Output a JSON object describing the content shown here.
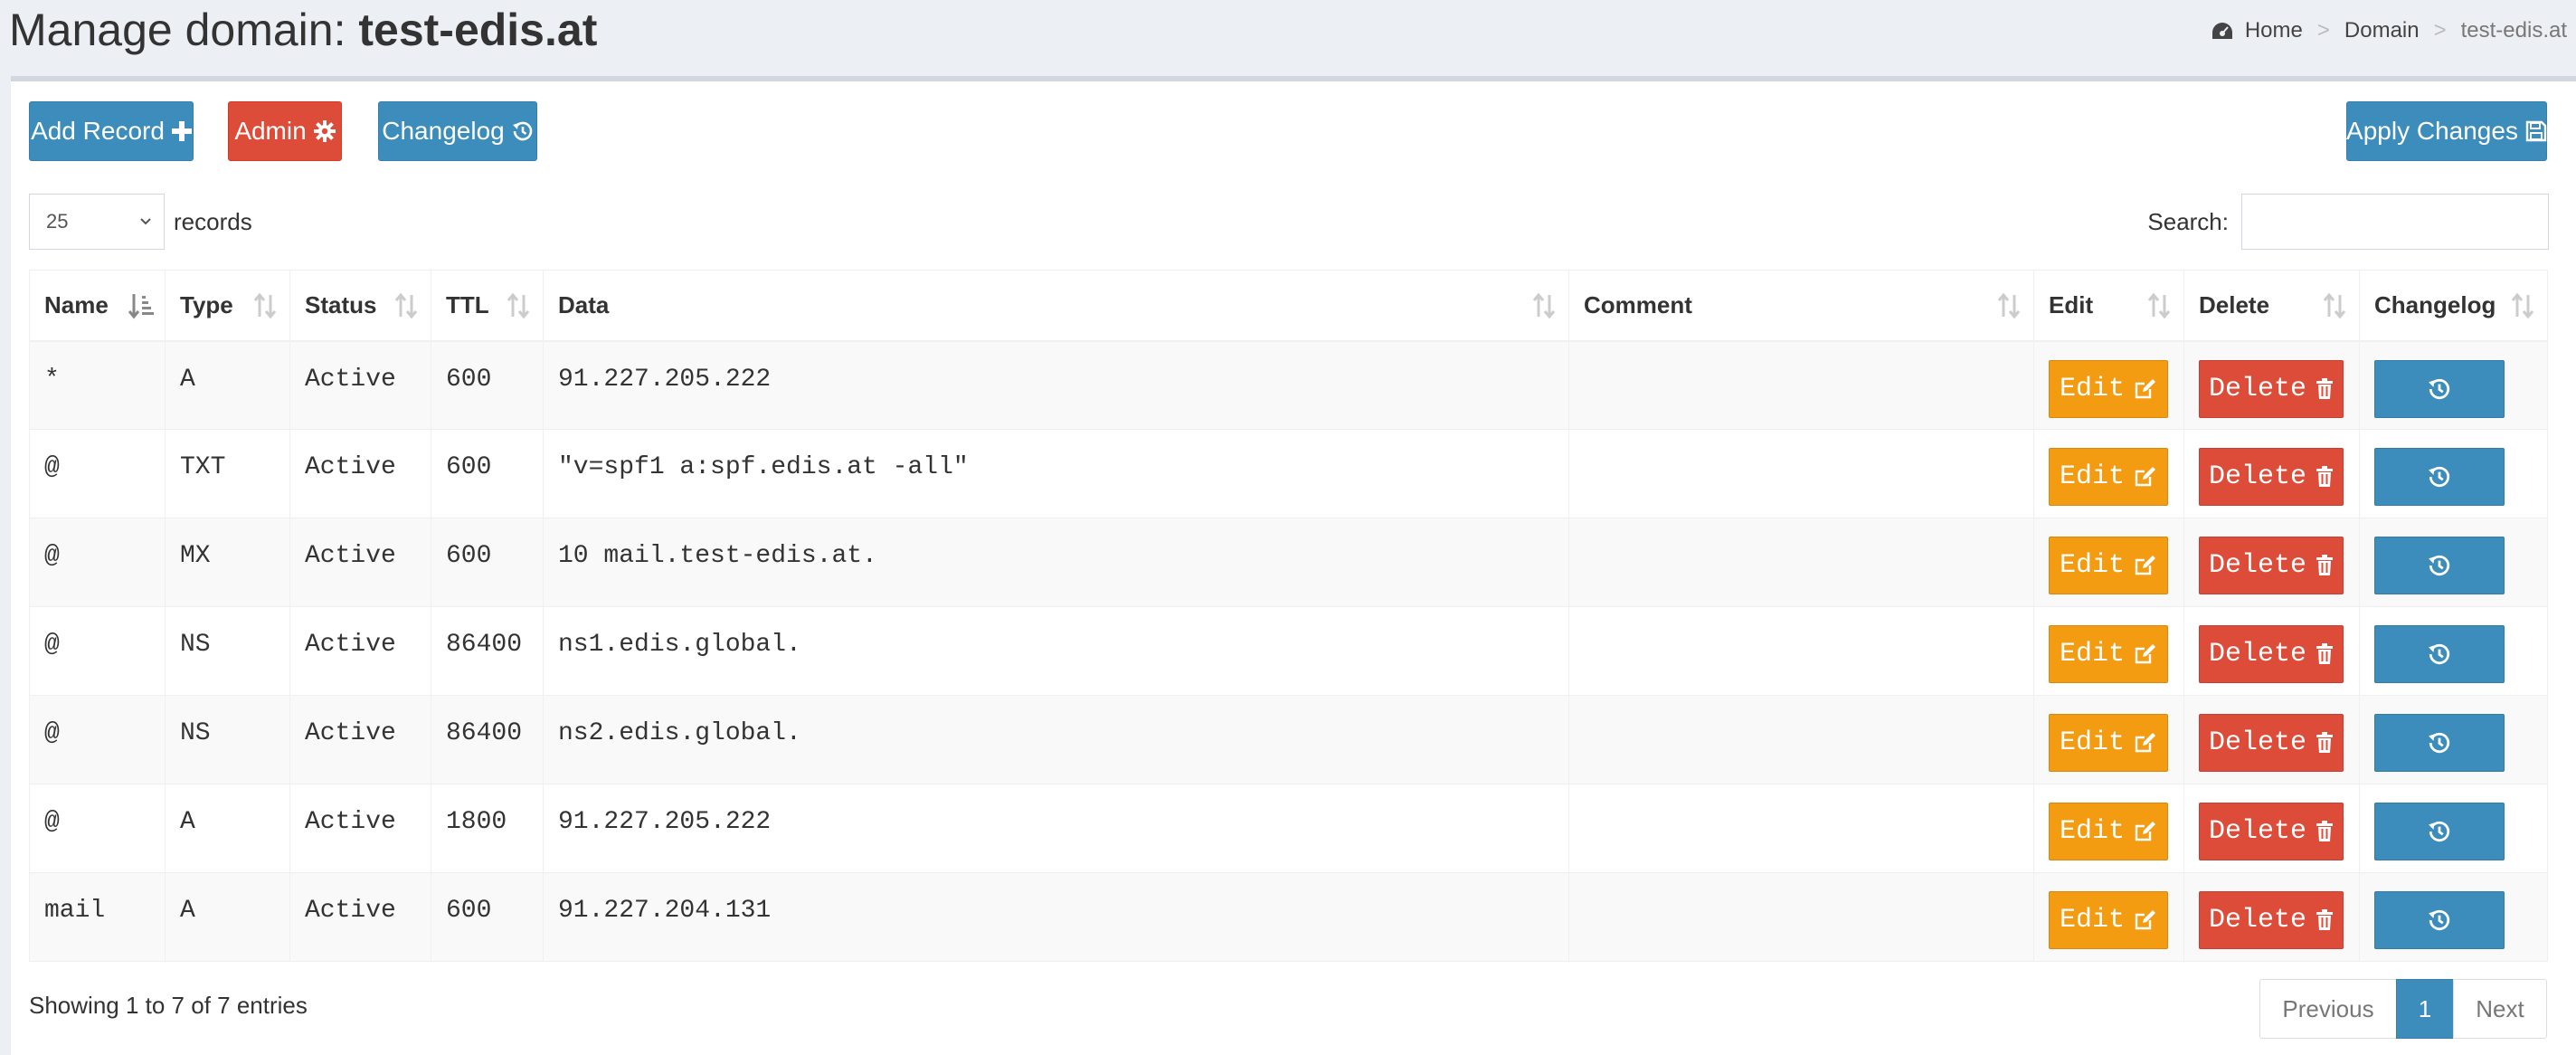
{
  "header": {
    "title_prefix": "Manage domain:",
    "domain": "test-edis.at"
  },
  "breadcrumb": {
    "home": "Home",
    "section": "Domain",
    "current": "test-edis.at",
    "separator": ">"
  },
  "toolbar": {
    "add_record": "Add Record",
    "admin": "Admin",
    "changelog": "Changelog",
    "apply_changes": "Apply Changes"
  },
  "length": {
    "value": "25",
    "label": "records"
  },
  "search": {
    "label": "Search:",
    "value": ""
  },
  "table": {
    "columns": [
      "Name",
      "Type",
      "Status",
      "TTL",
      "Data",
      "Comment",
      "Edit",
      "Delete",
      "Changelog"
    ],
    "rows": [
      {
        "name": "*",
        "type": "A",
        "status": "Active",
        "ttl": "600",
        "data": "91.227.205.222",
        "comment": ""
      },
      {
        "name": "@",
        "type": "TXT",
        "status": "Active",
        "ttl": "600",
        "data": "\"v=spf1 a:spf.edis.at -all\"",
        "comment": ""
      },
      {
        "name": "@",
        "type": "MX",
        "status": "Active",
        "ttl": "600",
        "data": "10 mail.test-edis.at.",
        "comment": ""
      },
      {
        "name": "@",
        "type": "NS",
        "status": "Active",
        "ttl": "86400",
        "data": "ns1.edis.global.",
        "comment": ""
      },
      {
        "name": "@",
        "type": "NS",
        "status": "Active",
        "ttl": "86400",
        "data": "ns2.edis.global.",
        "comment": ""
      },
      {
        "name": "@",
        "type": "A",
        "status": "Active",
        "ttl": "1800",
        "data": "91.227.205.222",
        "comment": ""
      },
      {
        "name": "mail",
        "type": "A",
        "status": "Active",
        "ttl": "600",
        "data": "91.227.204.131",
        "comment": ""
      }
    ],
    "edit_label": "Edit",
    "delete_label": "Delete"
  },
  "footer": {
    "info": "Showing 1 to 7 of 7 entries",
    "previous": "Previous",
    "current_page": "1",
    "next": "Next"
  },
  "colors": {
    "primary": "#3c8dbc",
    "danger": "#dd4b39",
    "warning": "#f39c12",
    "background": "#ecf0f5"
  },
  "icons": {
    "home": "dashboard-icon",
    "add": "plus-icon",
    "admin": "gear-icon",
    "changelog": "history-icon",
    "apply": "save-icon",
    "edit": "edit-icon",
    "delete": "trash-icon",
    "sort": "sort-icon"
  }
}
